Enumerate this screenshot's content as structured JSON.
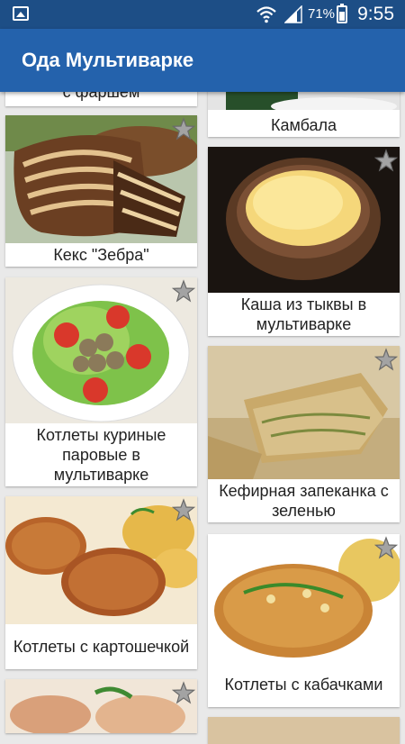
{
  "status_bar": {
    "battery_percent": "71%",
    "time": "9:55",
    "icons": [
      "gallery-icon",
      "wifi-icon",
      "signal-icon",
      "battery-icon"
    ]
  },
  "app_bar": {
    "title": "Ода Мультиварке"
  },
  "recipes": {
    "left": [
      {
        "title": "с фаршем"
      },
      {
        "title": "Кекс \"Зебра\""
      },
      {
        "title": "Котлеты куриные паровые в мультиварке"
      },
      {
        "title": "Котлеты с картошечкой"
      },
      {
        "title": ""
      }
    ],
    "right": [
      {
        "title": "Камбала"
      },
      {
        "title": "Каша из тыквы в мультиварке"
      },
      {
        "title": "Кефирная запеканка с зеленью"
      },
      {
        "title": "Котлеты с кабачками"
      },
      {
        "title": ""
      }
    ]
  },
  "colors": {
    "status_bar": "#1d4e86",
    "app_bar": "#2462ac",
    "background": "#e9e9e9",
    "card": "#ffffff",
    "star": "#9a9a9a"
  }
}
